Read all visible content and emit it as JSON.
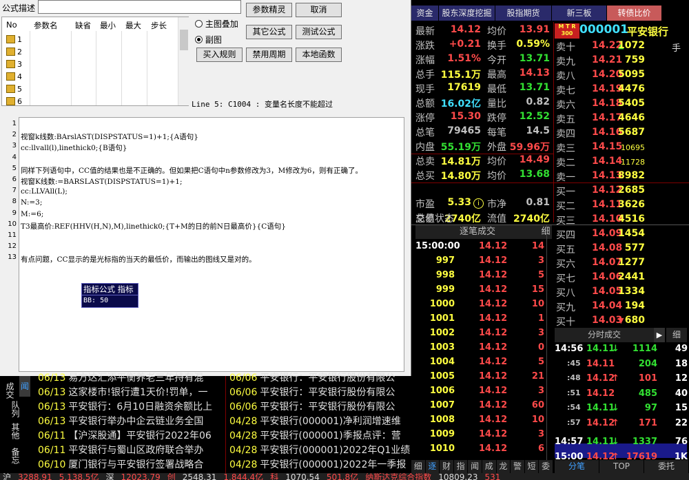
{
  "dialog": {
    "desc_label": "公式描述",
    "table_headers": [
      "No",
      "参数名",
      "缺省",
      "最小",
      "最大",
      "步长"
    ],
    "row_numbers": [
      "1",
      "2",
      "3",
      "4",
      "5",
      "6"
    ],
    "radio_main": "主图叠加",
    "radio_sub": "副图",
    "buttons": {
      "param_wizard": "参数精灵",
      "cancel": "取消",
      "other_formula": "其它公式",
      "test_formula": "测试公式",
      "buy_rule": "买入规则",
      "disable_period": "禁用周期",
      "local_func": "本地函数"
    },
    "error_msg": "Line 5: C1004 : 变量名长度不能超过",
    "code_lines": [
      {
        "n": "1",
        "t": ""
      },
      {
        "n": "2",
        "t": "视窗k线数:BArslAST(DISPSTATUS=1)+1;{A语句}"
      },
      {
        "n": "3",
        "t": "cc:llvall(l),linethick0;{B语句}"
      },
      {
        "n": "4",
        "t": ""
      },
      {
        "n": "5",
        "t": "同样下列语句中，CC值的结果也是不正确的。但如果把C语句中n参数修改为3，M修改为6，则有正确了。"
      },
      {
        "n": "6",
        "t": "视窗K线数:=BARSLAST(DISPSTATUS=1)+1;"
      },
      {
        "n": "7",
        "t": "cc:LLVAll(L);"
      },
      {
        "n": "8",
        "t": "N:=3;"
      },
      {
        "n": "9",
        "t": "M:=6;"
      },
      {
        "n": "10",
        "t": "T3最高价:REF(HHV(H,N),M),linethick0;{T+M的日的前N日最高价}{C语句}"
      },
      {
        "n": "11",
        "t": ""
      },
      {
        "n": "12",
        "t": ""
      },
      {
        "n": "13",
        "t": "有点问题，CC显示的是光标指的当天的最低价，而输出的图线又是对的。"
      }
    ],
    "tooltip_title": "指标公式 指标",
    "tooltip_value": "BB:   50"
  },
  "quote": {
    "tabs": [
      "资金",
      "股东深度挖掘",
      "股指期货",
      "新三板",
      "转债比价"
    ],
    "code": "000001",
    "name": "平安银行",
    "mtr": "M T R",
    "mtr2": "300",
    "stats": [
      {
        "l": "最新",
        "v": "14.12",
        "vc": "red",
        "l2": "均价",
        "v2": "13.91",
        "v2c": "red"
      },
      {
        "l": "涨跌",
        "v": "+0.21",
        "vc": "red",
        "l2": "换手",
        "v2": "0.59%",
        "v2c": "yel"
      },
      {
        "l": "涨幅",
        "v": "1.51%",
        "vc": "red",
        "l2": "今开",
        "v2": "13.71",
        "v2c": "grn"
      },
      {
        "l": "总手",
        "v": "115.1万",
        "vc": "yel",
        "l2": "最高",
        "v2": "14.13",
        "v2c": "red"
      },
      {
        "l": "现手",
        "v": "17619",
        "vc": "yel",
        "l2": "最低",
        "v2": "13.71",
        "v2c": "grn"
      },
      {
        "l": "总额",
        "v": "16.02亿",
        "vc": "cyn",
        "l2": "量比",
        "v2": "0.82",
        "v2c": "lbl"
      },
      {
        "l": "涨停",
        "v": "15.30",
        "vc": "red",
        "l2": "跌停",
        "v2": "12.52",
        "v2c": "grn"
      },
      {
        "l": "总笔",
        "v": "79465",
        "vc": "lbl",
        "l2": "每笔",
        "v2": "14.5",
        "v2c": "lbl"
      },
      {
        "l": "内盘",
        "v": "55.19万",
        "vc": "grn",
        "l2": "外盘",
        "v2": "59.96万",
        "v2c": "red"
      },
      {
        "l": "总卖",
        "v": "14.81万",
        "vc": "yel",
        "l2": "均价",
        "v2": "14.49",
        "v2c": "red"
      },
      {
        "l": "总买",
        "v": "14.80万",
        "vc": "yel",
        "l2": "均价",
        "v2": "13.68",
        "v2c": "grn"
      },
      {
        "l": "市盈",
        "v": "5.33",
        "vc": "yel",
        "l2": "市净",
        "v2": "0.81",
        "v2c": "lbl"
      },
      {
        "l": "总值",
        "v": "2740亿",
        "vc": "yel",
        "l2": "流值",
        "v2": "2740亿",
        "v2c": "yel"
      }
    ],
    "trade_status": "交易状态",
    "sell": [
      {
        "l": "卖十",
        "p": "14.22",
        "q": "1072",
        "arrow": "up"
      },
      {
        "l": "卖九",
        "p": "14.21",
        "q": "759"
      },
      {
        "l": "卖八",
        "p": "14.20",
        "q": "5095"
      },
      {
        "l": "卖七",
        "p": "14.19",
        "q": "4476"
      },
      {
        "l": "卖六",
        "p": "14.18",
        "q": "5405"
      },
      {
        "l": "卖五",
        "p": "14.17",
        "q": "4646"
      },
      {
        "l": "卖四",
        "p": "14.16",
        "q": "5687"
      },
      {
        "l": "卖三",
        "p": "14.15",
        "q": "10695"
      },
      {
        "l": "卖二",
        "p": "14.14",
        "q": "11728"
      },
      {
        "l": "卖一",
        "p": "14.13",
        "q": "8982"
      }
    ],
    "buy": [
      {
        "l": "买一",
        "p": "14.12",
        "q": "2685"
      },
      {
        "l": "买二",
        "p": "14.11",
        "q": "3626"
      },
      {
        "l": "买三",
        "p": "14.10",
        "q": "4516"
      },
      {
        "l": "买四",
        "p": "14.09",
        "q": "1454"
      },
      {
        "l": "买五",
        "p": "14.08",
        "q": "577"
      },
      {
        "l": "买六",
        "p": "14.07",
        "q": "1277"
      },
      {
        "l": "买七",
        "p": "14.06",
        "q": "2441"
      },
      {
        "l": "买八",
        "p": "14.05",
        "q": "1334"
      },
      {
        "l": "买九",
        "p": "14.04",
        "q": "194"
      },
      {
        "l": "买十",
        "p": "14.03",
        "q": "680",
        "arrow": "down"
      }
    ],
    "side_char": "手",
    "tick_title": "逐笔成交",
    "tick_side": "细",
    "ticks": [
      {
        "t": "15:00:00",
        "p": "14.12",
        "q": "14"
      },
      {
        "t": "997",
        "p": "14.12",
        "q": "3"
      },
      {
        "t": "998",
        "p": "14.12",
        "q": "5"
      },
      {
        "t": "999",
        "p": "14.12",
        "q": "15"
      },
      {
        "t": "1000",
        "p": "14.12",
        "q": "10"
      },
      {
        "t": "1001",
        "p": "14.12",
        "q": "1"
      },
      {
        "t": "1002",
        "p": "14.12",
        "q": "3"
      },
      {
        "t": "1003",
        "p": "14.12",
        "q": "0"
      },
      {
        "t": "1004",
        "p": "14.12",
        "q": "5"
      },
      {
        "t": "1005",
        "p": "14.12",
        "q": "21"
      },
      {
        "t": "1006",
        "p": "14.12",
        "q": "3"
      },
      {
        "t": "1007",
        "p": "14.12",
        "q": "60"
      },
      {
        "t": "1008",
        "p": "14.12",
        "q": "10"
      },
      {
        "t": "1009",
        "p": "14.12",
        "q": "3"
      },
      {
        "t": "1010",
        "p": "14.12",
        "q": "6"
      }
    ],
    "fen_title": "分时成交",
    "fen_side": "细",
    "fens": [
      {
        "t": "14:56",
        "p": "14.11",
        "a": "down",
        "v": "1114",
        "n": "49"
      },
      {
        "t": ":45",
        "p": "14.11",
        "a": "",
        "v": "204",
        "n": "18"
      },
      {
        "t": ":48",
        "p": "14.12",
        "a": "up",
        "v": "101",
        "n": "12"
      },
      {
        "t": ":51",
        "p": "14.12",
        "a": "",
        "v": "485",
        "n": "40"
      },
      {
        "t": ":54",
        "p": "14.11",
        "a": "down",
        "v": "97",
        "n": "15"
      },
      {
        "t": ":57",
        "p": "14.12",
        "a": "up",
        "v": "171",
        "n": "22"
      },
      {
        "t": "14:57",
        "p": "14.11",
        "a": "down",
        "v": "1337",
        "n": "76"
      },
      {
        "t": "15:00",
        "p": "14.12",
        "a": "up",
        "v": "17619",
        "n": "1K"
      }
    ],
    "bottom_tabs": [
      "细",
      "逐",
      "财",
      "指",
      "闻",
      "成",
      "龙",
      "警",
      "短",
      "委"
    ],
    "bottom_tabs2": [
      "分笔",
      "TOP",
      "委托"
    ]
  },
  "news": {
    "side_tabs": [
      "成交",
      "队列",
      "其他",
      "备忘"
    ],
    "side_active": "闻",
    "left": [
      {
        "d": "06/13",
        "t": "易方达汇添平衡养老三年持有混"
      },
      {
        "d": "06/13",
        "t": "这家楼市!银行遭1天价!罚单，一"
      },
      {
        "d": "06/13",
        "t": "平安银行：6月10日融资余额比上"
      },
      {
        "d": "06/13",
        "t": "平安银行举办中企云链业务全国"
      },
      {
        "d": "06/11",
        "t": "【沪深股通】平安银行2022年06"
      },
      {
        "d": "06/11",
        "t": "平安银行与蜀山区政府联合举办"
      },
      {
        "d": "06/10",
        "t": "厦门银行与平安银行签署战略合"
      }
    ],
    "right": [
      {
        "d": "06/06",
        "t": "平安银行：平安银行股份有限公"
      },
      {
        "d": "06/06",
        "t": "平安银行：平安银行股份有限公"
      },
      {
        "d": "06/06",
        "t": "平安银行：平安银行股份有限公"
      },
      {
        "d": "04/28",
        "t": "平安银行(000001)净利润增速维"
      },
      {
        "d": "04/28",
        "t": "平安银行(000001)季报点评：营"
      },
      {
        "d": "04/28",
        "t": "平安银行(000001)2022年Q1业绩"
      },
      {
        "d": "04/28",
        "t": "平安银行(000001)2022年一季报"
      }
    ]
  },
  "status": {
    "items": [
      "沪",
      "3288.91",
      "5,138.5亿",
      "深",
      "12023.79",
      "创",
      "2548.31",
      "1,844.4亿",
      "科",
      "1070.54",
      "501.8亿",
      "纳斯达克综合指数",
      "10809.23",
      "531"
    ]
  }
}
